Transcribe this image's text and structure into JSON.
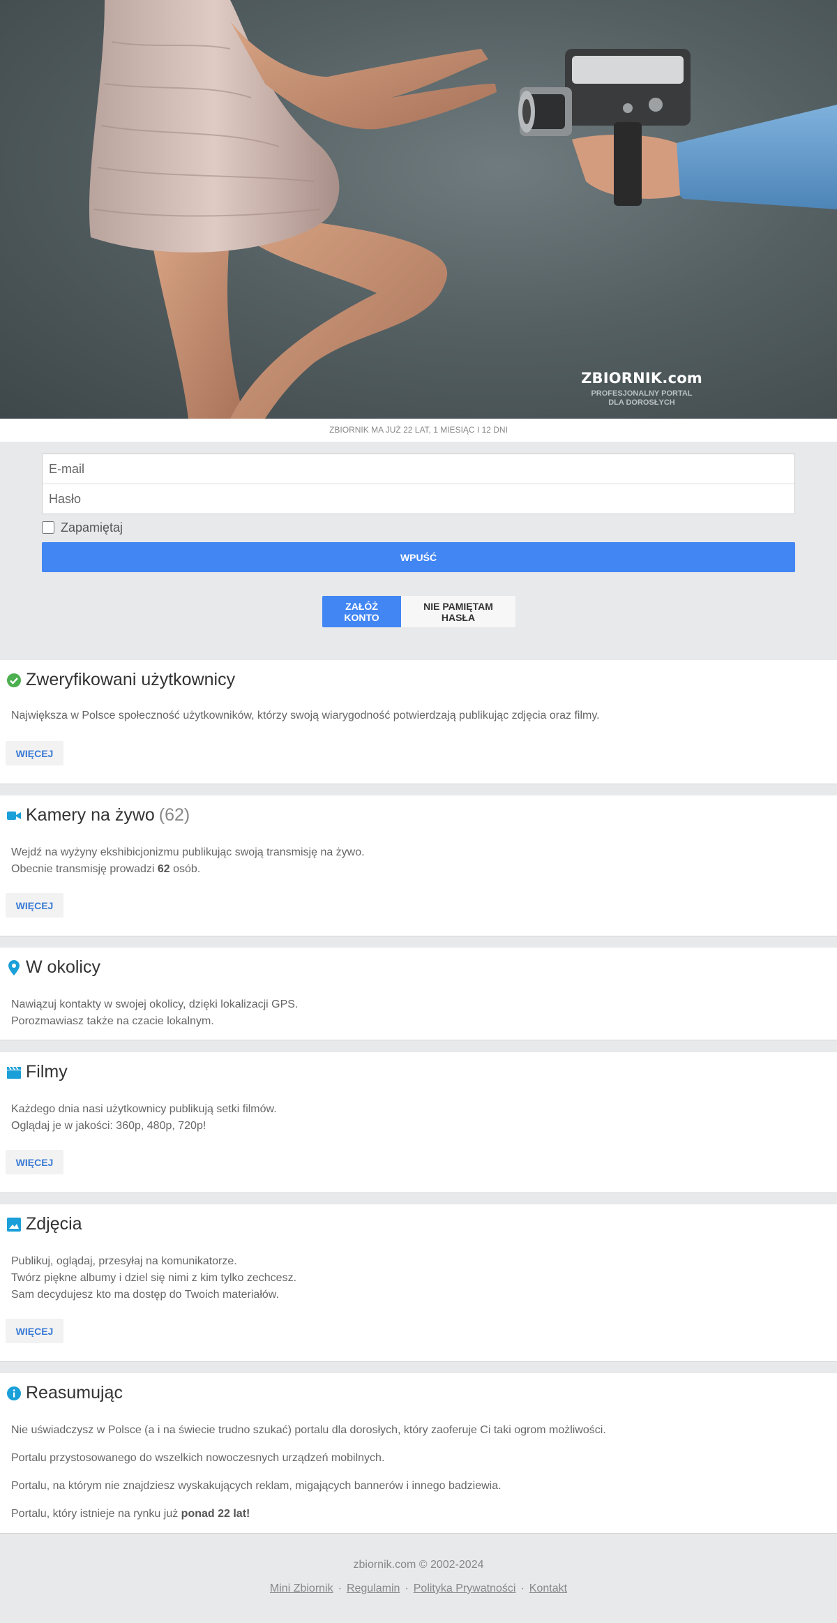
{
  "hero": {
    "brand_name": "ZBIORNIK.com",
    "brand_sub_1": "PROFESJONALNY PORTAL",
    "brand_sub_2": "DLA DOROSŁYCH"
  },
  "age_text": "ZBIORNIK MA JUŻ 22 LAT, 1 MIESIĄC I 12 DNI",
  "login": {
    "email_placeholder": "E-mail",
    "email_value": "",
    "password_placeholder": "Hasło",
    "password_value": "",
    "remember_label": "Zapamiętaj",
    "remember_checked": false,
    "submit_label": "WPUŚĆ",
    "register_label": "ZAŁÓŻ KONTO",
    "forgot_label": "NIE PAMIĘTAM HASŁA"
  },
  "sections": {
    "verified": {
      "title": "Zweryfikowani użytkownicy",
      "icon": "check-circle-icon",
      "icon_color": "#4caf50",
      "text": "Największa w Polsce społeczność użytkowników, którzy swoją wiarygodność potwierdzają publikując zdjęcia oraz filmy.",
      "more_label": "WIĘCEJ"
    },
    "cams": {
      "title": "Kamery na żywo",
      "count": "(62)",
      "icon": "video-camera-icon",
      "icon_color": "#1a9fd9",
      "line1": "Wejdź na wyżyny ekshibicjonizmu publikując swoją transmisję na żywo.",
      "line2_prefix": "Obecnie transmisję prowadzi",
      "line2_count": "62",
      "line2_suffix": "osób.",
      "more_label": "WIĘCEJ"
    },
    "nearby": {
      "title": "W okolicy",
      "icon": "map-pin-icon",
      "icon_color": "#1a9fd9",
      "line1": "Nawiązuj kontakty w swojej okolicy, dzięki lokalizacji GPS.",
      "line2": "Porozmawiasz także na czacie lokalnym."
    },
    "films": {
      "title": "Filmy",
      "icon": "clapperboard-icon",
      "icon_color": "#1a9fd9",
      "line1": "Każdego dnia nasi użytkownicy publikują setki filmów.",
      "line2": "Oglądaj je w jakości: 360p, 480p, 720p!",
      "more_label": "WIĘCEJ"
    },
    "photos": {
      "title": "Zdjęcia",
      "icon": "image-icon",
      "icon_color": "#1a9fd9",
      "line1": "Publikuj, oglądaj, przesyłaj na komunikatorze.",
      "line2": "Twórz piękne albumy i dziel się nimi z kim tylko zechcesz.",
      "line3": "Sam decydujesz kto ma dostęp do Twoich materiałów.",
      "more_label": "WIĘCEJ"
    },
    "summary": {
      "title": "Reasumując",
      "icon": "info-circle-icon",
      "icon_color": "#1a9fd9",
      "p1": "Nie uświadczysz w Polsce (a i na świecie trudno szukać) portalu dla dorosłych, który zaoferuje Ci taki ogrom możliwości.",
      "p2": "Portalu przystosowanego do wszelkich nowoczesnych urządzeń mobilnych.",
      "p3": "Portalu, na którym nie znajdziesz wyskakujących reklam, migających bannerów i innego badziewia.",
      "p4_prefix": "Portalu, który istnieje na rynku już",
      "p4_bold": "ponad 22 lat!"
    }
  },
  "footer": {
    "copyright": "zbiornik.com © 2002-2024",
    "links": [
      "Mini Zbiornik",
      "Regulamin",
      "Polityka Prywatności",
      "Kontakt"
    ],
    "separator": "·"
  },
  "colors": {
    "accent": "#4286f4",
    "page_bg": "#e8e9eb",
    "more_text": "#3a7bd5"
  }
}
